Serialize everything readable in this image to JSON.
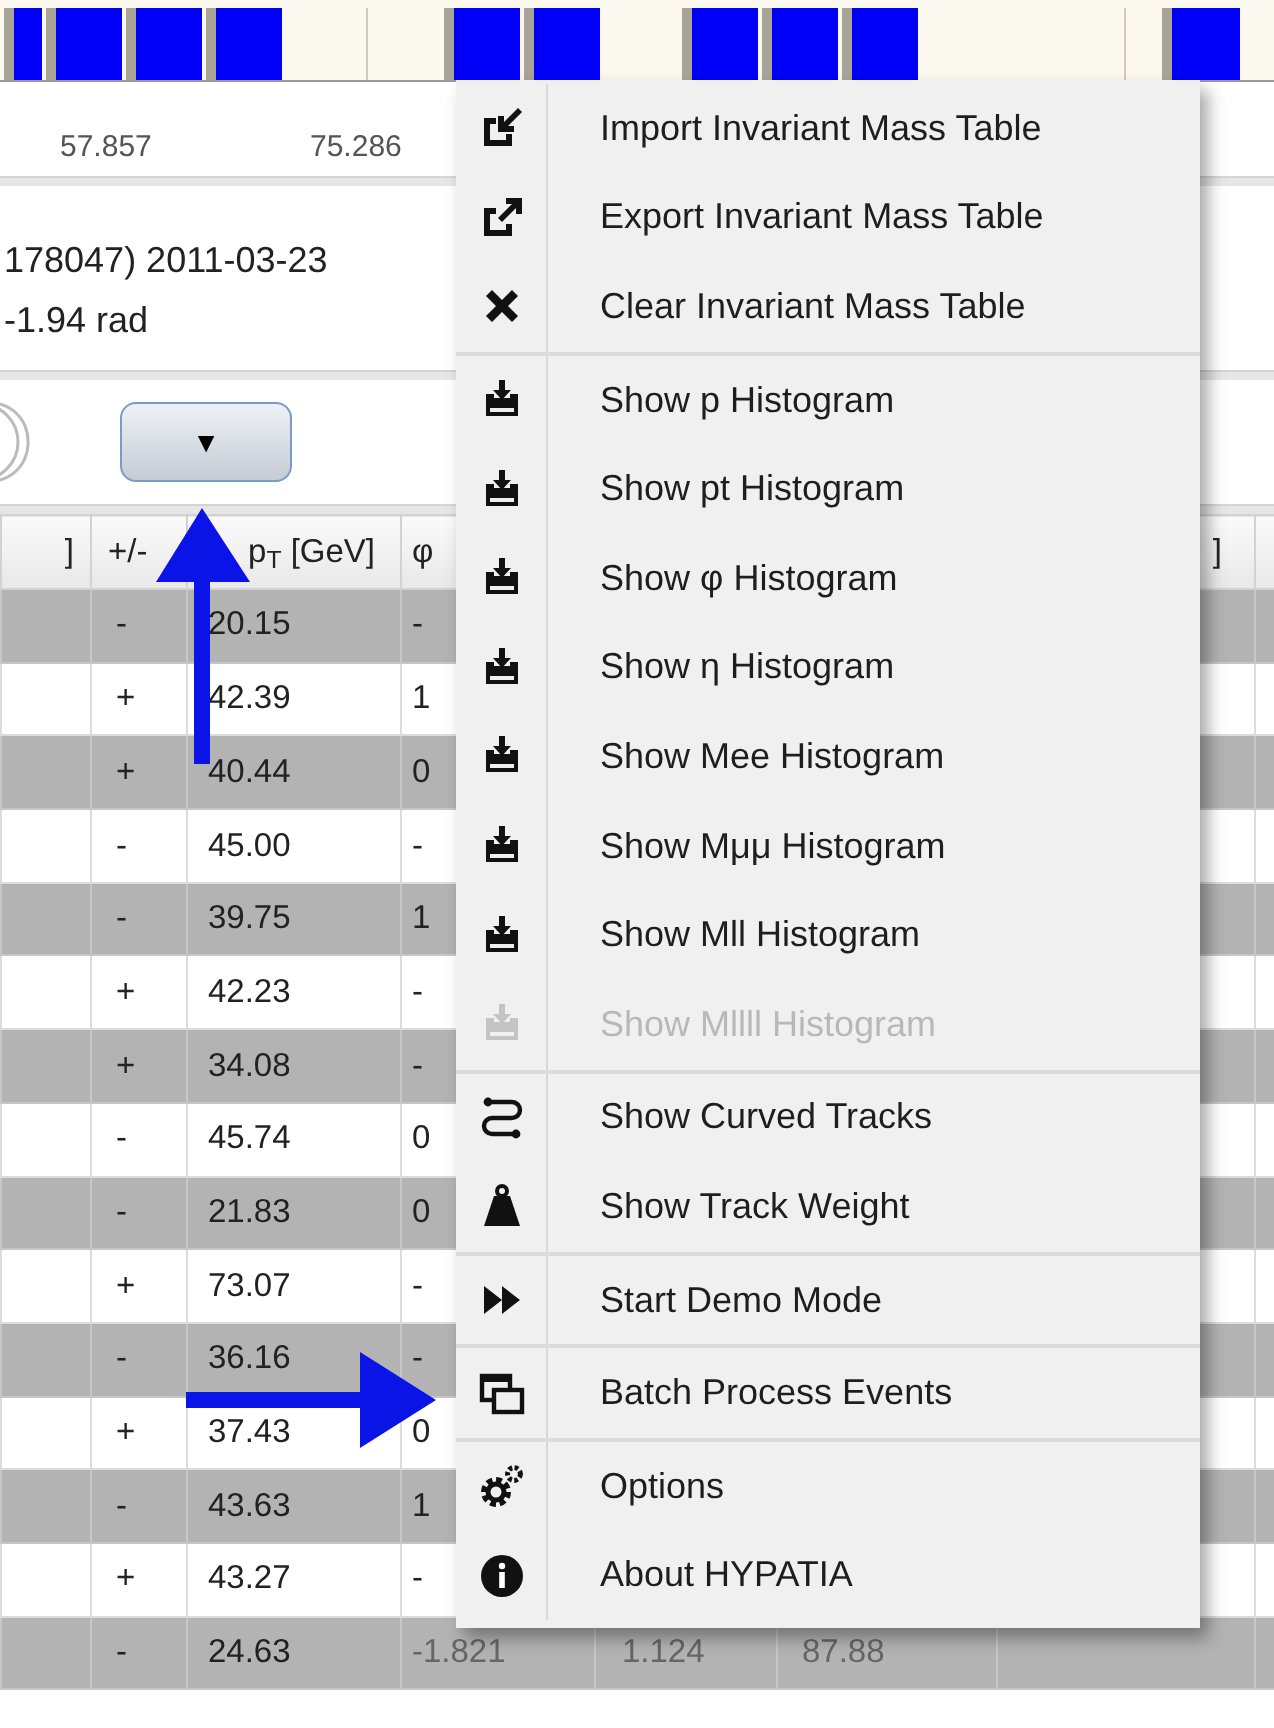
{
  "axis": {
    "ticks": [
      "57.857",
      "75.286"
    ]
  },
  "info": {
    "lines": [
      "178047) 2011-03-23",
      "-1.94 rad"
    ]
  },
  "dropdown": {
    "label": "▼"
  },
  "table": {
    "header": [
      "]",
      "+/-",
      "p$_{T}$ [GeV]",
      "φ"
    ],
    "header_right": "]",
    "rows": [
      {
        "sign": "-",
        "pt": "20.15",
        "phi": "-"
      },
      {
        "sign": "+",
        "pt": "42.39",
        "phi": "1"
      },
      {
        "sign": "+",
        "pt": "40.44",
        "phi": "0"
      },
      {
        "sign": "-",
        "pt": "45.00",
        "phi": "-"
      },
      {
        "sign": "-",
        "pt": "39.75",
        "phi": "1"
      },
      {
        "sign": "+",
        "pt": "42.23",
        "phi": "-"
      },
      {
        "sign": "+",
        "pt": "34.08",
        "phi": "-"
      },
      {
        "sign": "-",
        "pt": "45.74",
        "phi": "0"
      },
      {
        "sign": "-",
        "pt": "21.83",
        "phi": "0"
      },
      {
        "sign": "+",
        "pt": "73.07",
        "phi": "-"
      },
      {
        "sign": "-",
        "pt": "36.16",
        "phi": "-"
      },
      {
        "sign": "+",
        "pt": "37.43",
        "phi": "0"
      },
      {
        "sign": "-",
        "pt": "43.63",
        "phi": "1"
      },
      {
        "sign": "+",
        "pt": "43.27",
        "phi": "-"
      },
      {
        "sign": "-",
        "pt": "24.63",
        "phi": "-1.821",
        "column_5": "1.124",
        "column_6": "87.88"
      }
    ]
  },
  "menu": {
    "groups": [
      {
        "items": [
          {
            "label": "Import Invariant Mass Table",
            "disabled": false
          },
          {
            "label": "Export Invariant Mass Table",
            "disabled": false
          },
          {
            "label": "Clear Invariant Mass Table",
            "disabled": false
          }
        ]
      },
      {
        "items": [
          {
            "label": "Show p Histogram",
            "disabled": false
          },
          {
            "label": "Show pt Histogram",
            "disabled": false
          },
          {
            "label": "Show φ Histogram",
            "disabled": false
          },
          {
            "label": "Show η Histogram",
            "disabled": false
          },
          {
            "label": "Show Mee Histogram",
            "disabled": false
          },
          {
            "label": "Show Mμμ Histogram",
            "disabled": false
          },
          {
            "label": "Show Mll Histogram",
            "disabled": false
          },
          {
            "label": "Show Mllll Histogram",
            "disabled": true
          }
        ]
      },
      {
        "items": [
          {
            "label": "Show Curved Tracks",
            "disabled": false
          },
          {
            "label": "Show Track Weight",
            "disabled": false
          }
        ]
      },
      {
        "items": [
          {
            "label": "Start Demo Mode",
            "disabled": false
          }
        ]
      },
      {
        "items": [
          {
            "label": "Batch Process Events",
            "disabled": false
          }
        ]
      },
      {
        "items": [
          {
            "label": "Options",
            "disabled": false
          },
          {
            "label": "About HYPATIA",
            "disabled": false
          }
        ]
      }
    ]
  }
}
